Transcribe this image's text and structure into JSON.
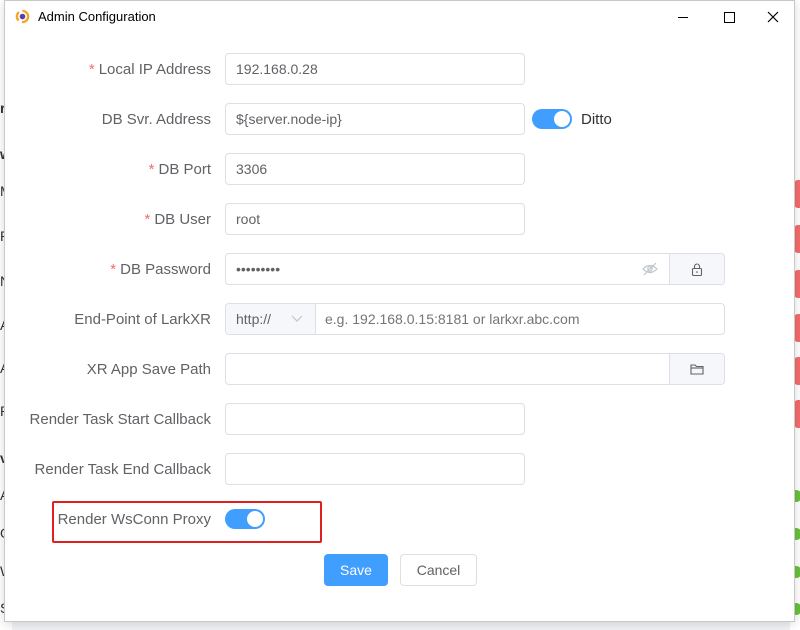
{
  "background": {
    "left_items": [
      "rl",
      "w",
      "M",
      "Re",
      "N",
      "Ad",
      "Ad",
      "Re",
      "vi",
      "Ac",
      "O",
      "W",
      "St"
    ]
  },
  "window": {
    "title": "Admin Configuration"
  },
  "form": {
    "local_ip": {
      "label": "Local IP Address",
      "required": "*",
      "value": "192.168.0.28"
    },
    "db_addr": {
      "label": "DB Svr. Address",
      "value": "${server.node-ip}",
      "ditto_label": "Ditto",
      "ditto_on": true
    },
    "db_port": {
      "label": "DB Port",
      "required": "*",
      "value": "3306"
    },
    "db_user": {
      "label": "DB User",
      "required": "*",
      "value": "root"
    },
    "db_password": {
      "label": "DB Password",
      "required": "*",
      "value": "•••••••••"
    },
    "endpoint": {
      "label": "End-Point of LarkXR",
      "protocol": "http://",
      "placeholder": "e.g. 192.168.0.15:8181 or larkxr.abc.com"
    },
    "save_path": {
      "label": "XR App Save Path",
      "value": ""
    },
    "start_callback": {
      "label": "Render Task Start Callback",
      "value": ""
    },
    "end_callback": {
      "label": "Render Task End Callback",
      "value": ""
    },
    "wsconn_proxy": {
      "label": "Render WsConn Proxy",
      "on": true
    }
  },
  "buttons": {
    "save": "Save",
    "cancel": "Cancel"
  },
  "colors": {
    "primary": "#409eff",
    "required": "#f56c6c",
    "highlight_box": "#e02020"
  }
}
